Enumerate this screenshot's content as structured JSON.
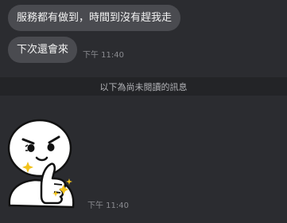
{
  "messages": [
    {
      "text": "服務都有做到，時間到沒有趕我走"
    },
    {
      "text": "下次還會來",
      "time": "下午 11:40"
    }
  ],
  "unread_divider": "以下為尚未閱讀的訊息",
  "sticker_message": {
    "sticker": "thumbs-up-sparkle-sticker",
    "time": "下午 11:40"
  },
  "colors": {
    "background": "#2b2c30",
    "divider_background": "#232427",
    "bubble": "#4a4b50",
    "text": "#f2f2f2",
    "timestamp": "#8a8b90",
    "sparkle": "#f2c21a"
  }
}
